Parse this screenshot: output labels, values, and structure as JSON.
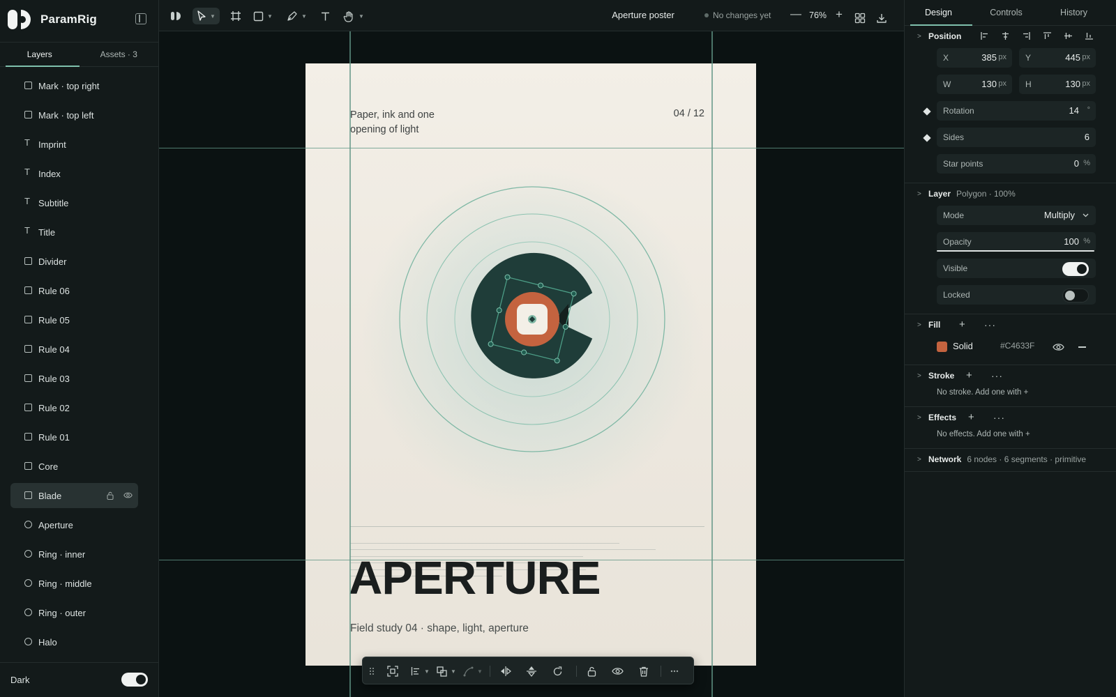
{
  "app": {
    "name": "ParamRig"
  },
  "left_tabs": [
    {
      "label": "Layers"
    },
    {
      "label": "Assets · 3"
    }
  ],
  "layers": [
    {
      "name": "Mark · top right",
      "icon": "square-icon"
    },
    {
      "name": "Mark · top left",
      "icon": "square-icon"
    },
    {
      "name": "Imprint",
      "icon": "text-icon"
    },
    {
      "name": "Index",
      "icon": "text-icon"
    },
    {
      "name": "Subtitle",
      "icon": "text-icon"
    },
    {
      "name": "Title",
      "icon": "text-icon"
    },
    {
      "name": "Divider",
      "icon": "square-icon"
    },
    {
      "name": "Rule 06",
      "icon": "square-icon"
    },
    {
      "name": "Rule 05",
      "icon": "square-icon"
    },
    {
      "name": "Rule 04",
      "icon": "square-icon"
    },
    {
      "name": "Rule 03",
      "icon": "square-icon"
    },
    {
      "name": "Rule 02",
      "icon": "square-icon"
    },
    {
      "name": "Rule 01",
      "icon": "square-icon"
    },
    {
      "name": "Core",
      "icon": "square-icon"
    },
    {
      "name": "Blade",
      "icon": "square-icon",
      "selected": true
    },
    {
      "name": "Aperture",
      "icon": "circle-icon"
    },
    {
      "name": "Ring · inner",
      "icon": "circle-icon"
    },
    {
      "name": "Ring · middle",
      "icon": "circle-icon"
    },
    {
      "name": "Ring · outer",
      "icon": "circle-icon"
    },
    {
      "name": "Halo",
      "icon": "circle-icon"
    }
  ],
  "theme": {
    "label": "Dark",
    "enabled": true
  },
  "topbar": {
    "doc_title": "Aperture poster",
    "save_status": "No changes yet",
    "zoom": "76%"
  },
  "poster": {
    "subtitle": "Paper, ink and one opening of light",
    "index": "04 / 12",
    "title": "APERTURE",
    "imprint": "Field study 04 · shape, light, aperture"
  },
  "right_tabs": [
    {
      "label": "Design"
    },
    {
      "label": "Controls"
    },
    {
      "label": "History"
    }
  ],
  "position": {
    "title": "Position",
    "x": {
      "label": "X",
      "value": "385",
      "unit": "px"
    },
    "y": {
      "label": "Y",
      "value": "445",
      "unit": "px"
    },
    "w": {
      "label": "W",
      "value": "130",
      "unit": "px"
    },
    "h": {
      "label": "H",
      "value": "130",
      "unit": "px"
    },
    "rotation": {
      "label": "Rotation",
      "value": "14",
      "unit": "°"
    },
    "sides": {
      "label": "Sides",
      "value": "6"
    },
    "star": {
      "label": "Star points",
      "value": "0",
      "unit": "%"
    }
  },
  "layer_section": {
    "title": "Layer",
    "meta": "Polygon · 100%",
    "mode": {
      "label": "Mode",
      "value": "Multiply"
    },
    "opacity": {
      "label": "Opacity",
      "value": "100",
      "unit": "%"
    },
    "visible": {
      "label": "Visible",
      "on": true
    },
    "locked": {
      "label": "Locked",
      "on": false
    }
  },
  "fill": {
    "title": "Fill",
    "type": "Solid",
    "hex": "#C4633F"
  },
  "stroke": {
    "title": "Stroke",
    "note": "No stroke. Add one with +"
  },
  "effects": {
    "title": "Effects",
    "note": "No effects. Add one with +"
  },
  "network": {
    "title": "Network",
    "meta": "6 nodes · 6 segments · primitive"
  },
  "colors": {
    "accent": "#7fc1ad",
    "guide": "#629686",
    "disc": "#1f3d39",
    "blade": "#C4633F"
  }
}
